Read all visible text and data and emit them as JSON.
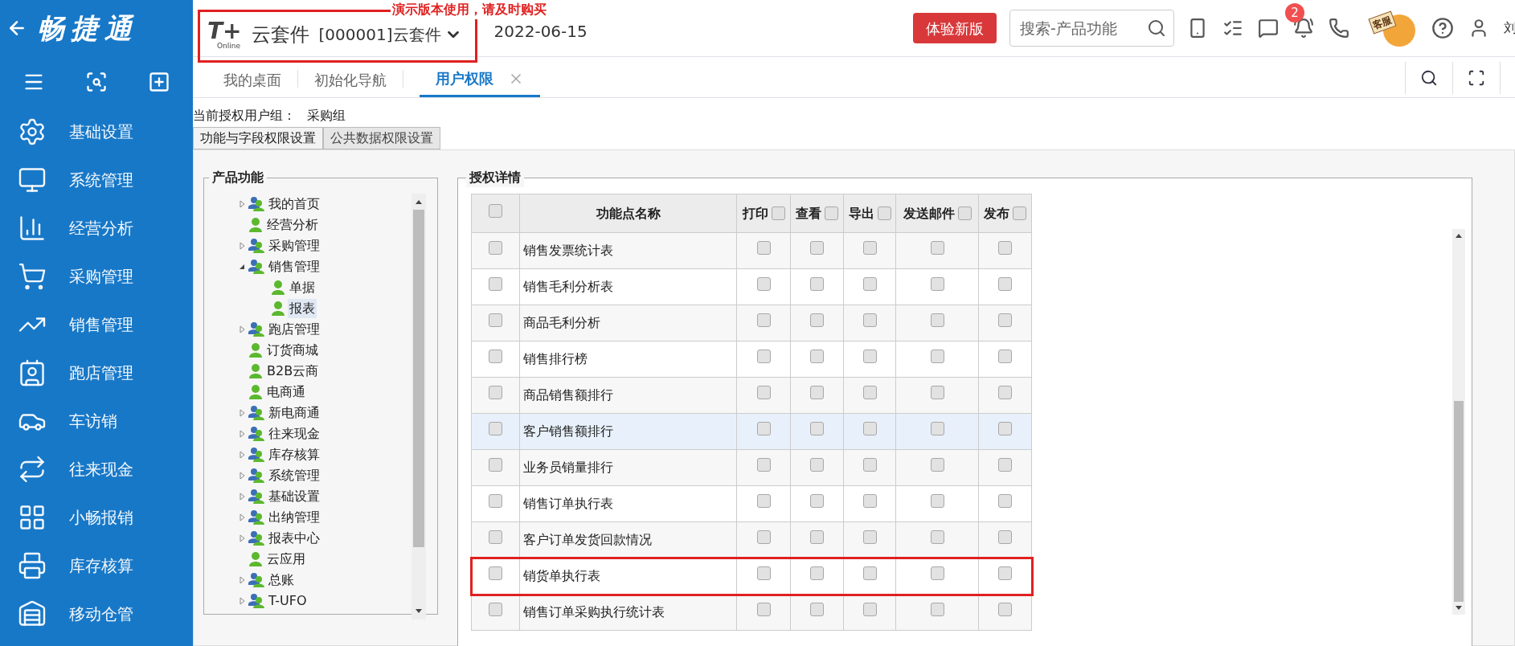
{
  "brand": {
    "name": "畅捷通"
  },
  "sidebar": {
    "items": [
      {
        "label": "基础设置"
      },
      {
        "label": "系统管理"
      },
      {
        "label": "经营分析"
      },
      {
        "label": "采购管理"
      },
      {
        "label": "销售管理"
      },
      {
        "label": "跑店管理"
      },
      {
        "label": "车访销"
      },
      {
        "label": "往来现金"
      },
      {
        "label": "小畅报销"
      },
      {
        "label": "库存核算"
      },
      {
        "label": "移动仓管"
      }
    ]
  },
  "header": {
    "product_logo": "T+",
    "product_sub": "Online",
    "product": "云套件",
    "account": "[000001]云套件",
    "date": "2022-06-15",
    "notice": "演示版本使用，请及时购买",
    "marked": true,
    "try_button": "体验新版",
    "search": {
      "placeholder": "搜索-产品功能"
    },
    "badge": "2",
    "service": "客服",
    "user": "刘"
  },
  "tabs": [
    {
      "label": "我的桌面",
      "selected": false,
      "closable": false
    },
    {
      "label": "初始化导航",
      "selected": false,
      "closable": false
    },
    {
      "label": "用户权限",
      "selected": true,
      "closable": true
    }
  ],
  "group": {
    "label": "当前授权用户组：",
    "value": "采购组"
  },
  "subtabs": [
    {
      "label": "功能与字段权限设置",
      "selected": true
    },
    {
      "label": "公共数据权限设置",
      "selected": false
    }
  ],
  "tree": {
    "title": "产品功能",
    "items": [
      {
        "label": "我的首页",
        "kind": "group",
        "expanded": false,
        "selected": false
      },
      {
        "label": "经营分析",
        "kind": "user",
        "selected": false
      },
      {
        "label": "采购管理",
        "kind": "group",
        "expanded": false,
        "selected": false
      },
      {
        "label": "销售管理",
        "kind": "group",
        "expanded": true,
        "selected": false,
        "children": [
          {
            "label": "单据",
            "kind": "user",
            "selected": false
          },
          {
            "label": "报表",
            "kind": "user",
            "selected": true
          }
        ]
      },
      {
        "label": "跑店管理",
        "kind": "group",
        "expanded": false,
        "selected": false
      },
      {
        "label": "订货商城",
        "kind": "user",
        "selected": false
      },
      {
        "label": "B2B云商",
        "kind": "user",
        "selected": false
      },
      {
        "label": "电商通",
        "kind": "user",
        "selected": false
      },
      {
        "label": "新电商通",
        "kind": "group",
        "expanded": false,
        "selected": false
      },
      {
        "label": "往来现金",
        "kind": "group",
        "expanded": false,
        "selected": false
      },
      {
        "label": "库存核算",
        "kind": "group",
        "expanded": false,
        "selected": false
      },
      {
        "label": "系统管理",
        "kind": "group",
        "expanded": false,
        "selected": false
      },
      {
        "label": "基础设置",
        "kind": "group",
        "expanded": false,
        "selected": false
      },
      {
        "label": "出纳管理",
        "kind": "group",
        "expanded": false,
        "selected": false
      },
      {
        "label": "报表中心",
        "kind": "group",
        "expanded": false,
        "selected": false
      },
      {
        "label": "云应用",
        "kind": "user",
        "selected": false
      },
      {
        "label": "总账",
        "kind": "group",
        "expanded": false,
        "selected": false
      },
      {
        "label": "T-UFO",
        "kind": "group",
        "expanded": false,
        "selected": false
      }
    ]
  },
  "details": {
    "title": "授权详情",
    "columns": [
      {
        "label": "功能点名称"
      },
      {
        "label": "打印",
        "checked": false
      },
      {
        "label": "查看",
        "checked": false
      },
      {
        "label": "导出",
        "checked": false
      },
      {
        "label": "发送邮件",
        "checked": false
      },
      {
        "label": "发布",
        "checked": false
      }
    ],
    "all_checked": false,
    "rows": [
      {
        "name": "销售发票统计表",
        "checked": false,
        "selected": false,
        "marked": false,
        "perms": [
          false,
          false,
          false,
          false,
          false
        ]
      },
      {
        "name": "销售毛利分析表",
        "checked": false,
        "selected": false,
        "marked": false,
        "perms": [
          false,
          false,
          false,
          false,
          false
        ]
      },
      {
        "name": "商品毛利分析",
        "checked": false,
        "selected": false,
        "marked": false,
        "perms": [
          false,
          false,
          false,
          false,
          false
        ]
      },
      {
        "name": "销售排行榜",
        "checked": false,
        "selected": false,
        "marked": false,
        "perms": [
          false,
          false,
          false,
          false,
          false
        ]
      },
      {
        "name": "商品销售额排行",
        "checked": false,
        "selected": false,
        "marked": false,
        "perms": [
          false,
          false,
          false,
          false,
          false
        ]
      },
      {
        "name": "客户销售额排行",
        "checked": false,
        "selected": true,
        "marked": false,
        "perms": [
          false,
          false,
          false,
          false,
          false
        ]
      },
      {
        "name": "业务员销量排行",
        "checked": false,
        "selected": false,
        "marked": false,
        "perms": [
          false,
          false,
          false,
          false,
          false
        ]
      },
      {
        "name": "销售订单执行表",
        "checked": false,
        "selected": false,
        "marked": false,
        "perms": [
          false,
          false,
          false,
          false,
          false
        ]
      },
      {
        "name": "客户订单发货回款情况",
        "checked": false,
        "selected": false,
        "marked": false,
        "perms": [
          false,
          false,
          false,
          false,
          false
        ]
      },
      {
        "name": "销货单执行表",
        "checked": false,
        "selected": false,
        "marked": true,
        "perms": [
          false,
          false,
          false,
          false,
          false
        ]
      },
      {
        "name": "销售订单采购执行统计表",
        "checked": false,
        "selected": false,
        "marked": false,
        "perms": [
          false,
          false,
          false,
          false,
          false
        ]
      }
    ]
  }
}
